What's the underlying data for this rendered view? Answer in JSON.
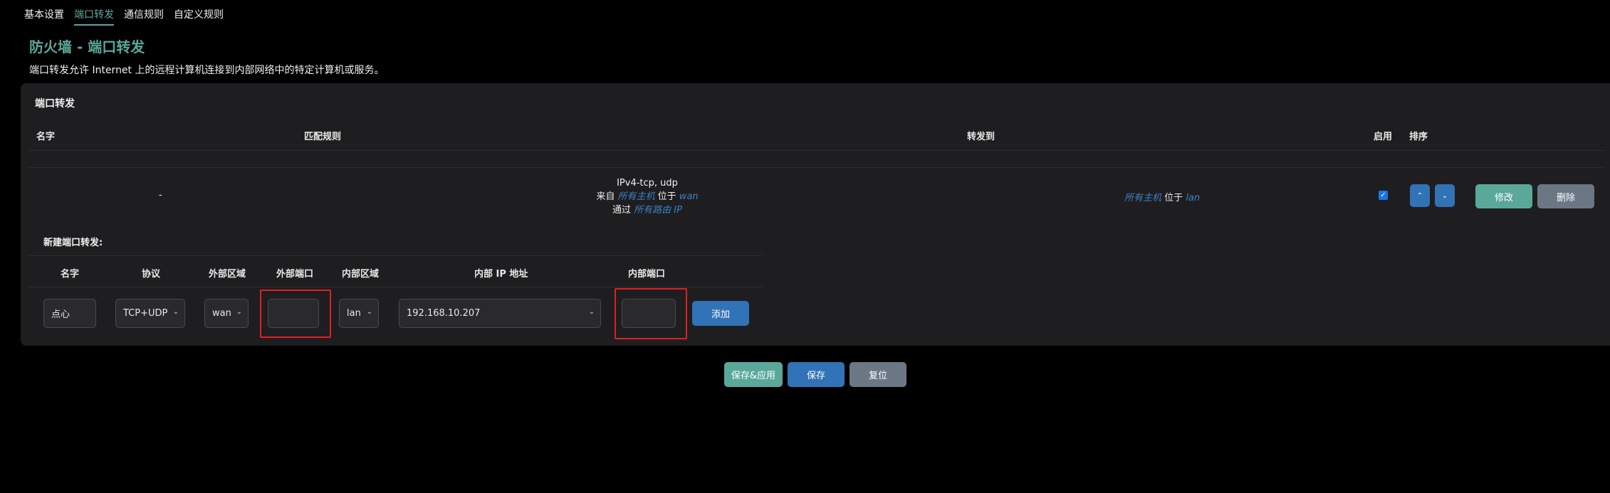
{
  "tabs": [
    "基本设置",
    "端口转发",
    "通信规则",
    "自定义规则"
  ],
  "page": {
    "title": "防火墙 - 端口转发",
    "description": "端口转发允许 Internet 上的远程计算机连接到内部网络中的特定计算机或服务。"
  },
  "section": {
    "title": "端口转发",
    "columns": {
      "name": "名字",
      "match": "匹配规则",
      "forward": "转发到",
      "enable": "启用",
      "sort": "排序"
    }
  },
  "rule": {
    "name": "-",
    "match_line1": "IPv4-tcp, udp",
    "from_label": "来自",
    "from_host": "所有主机",
    "at_label": "位于",
    "from_zone": "wan",
    "via_label": "通过",
    "via_ip": "所有路由 IP",
    "forward_host": "所有主机",
    "forward_at": "位于",
    "forward_zone": "lan",
    "enabled": true,
    "up_icon": "chevron-up-icon",
    "down_icon": "chevron-down-icon",
    "edit_label": "修改",
    "delete_label": "删除"
  },
  "new_rule": {
    "title": "新建端口转发:",
    "columns": {
      "name": "名字",
      "protocol": "协议",
      "ext_zone": "外部区域",
      "ext_port": "外部端口",
      "int_zone": "内部区域",
      "int_ip": "内部 IP 地址",
      "int_port": "内部端口"
    },
    "name_value": "点心",
    "protocol_value": "TCP+UDP",
    "ext_zone_value": "wan",
    "ext_port_value": "",
    "int_zone_value": "lan",
    "int_ip_value": "192.168.10.207",
    "int_port_value": "",
    "add_label": "添加"
  },
  "footer": {
    "save_apply": "保存&应用",
    "save": "保存",
    "reset": "复位"
  },
  "colors": {
    "accent": "#5aa89a",
    "primary": "#3272b6",
    "neutral": "#6b7785",
    "highlight": "#e02020"
  }
}
